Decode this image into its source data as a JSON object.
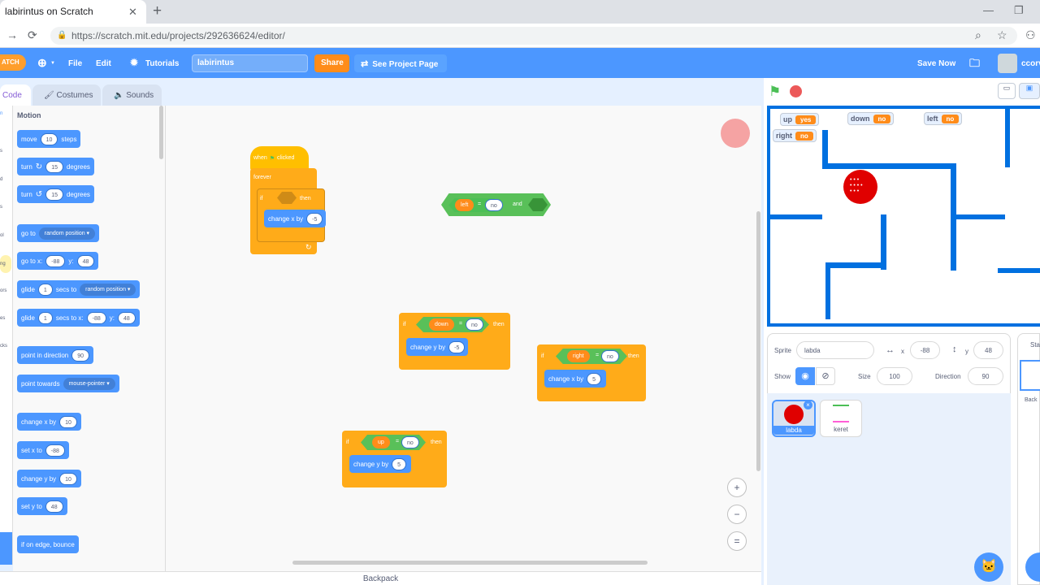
{
  "browser": {
    "tab_title": "labirintus on Scratch",
    "url": "https://scratch.mit.edu/projects/292636624/editor/"
  },
  "menu": {
    "file": "File",
    "edit": "Edit",
    "tutorials": "Tutorials",
    "project_title": "labirintus",
    "share": "Share",
    "see_project_page": "See Project Page",
    "save_now": "Save Now",
    "username": "ccorv"
  },
  "editor_tabs": {
    "code": "Code",
    "costumes": "Costumes",
    "sounds": "Sounds"
  },
  "categories": [
    "n",
    "s",
    "d",
    "s",
    "ol",
    "ng",
    "ors",
    "es",
    "cks"
  ],
  "palette": {
    "heading": "Motion",
    "blocks": [
      {
        "text": [
          "move",
          "10",
          "steps"
        ]
      },
      {
        "text": [
          "turn",
          "↻",
          "15",
          "degrees"
        ]
      },
      {
        "text": [
          "turn",
          "↺",
          "15",
          "degrees"
        ]
      },
      {
        "text": [
          "go to",
          "random position ▾"
        ]
      },
      {
        "text": [
          "go to x:",
          "-88",
          "y:",
          "48"
        ]
      },
      {
        "text": [
          "glide",
          "1",
          "secs to",
          "random position ▾"
        ]
      },
      {
        "text": [
          "glide",
          "1",
          "secs to x:",
          "-88",
          "y:",
          "48"
        ]
      },
      {
        "text": [
          "point in direction",
          "90"
        ]
      },
      {
        "text": [
          "point towards",
          "mouse-pointer ▾"
        ]
      },
      {
        "text": [
          "change x by",
          "10"
        ]
      },
      {
        "text": [
          "set x to",
          "-88"
        ]
      },
      {
        "text": [
          "change y by",
          "10"
        ]
      },
      {
        "text": [
          "set y to",
          "48"
        ]
      },
      {
        "text": [
          "if on edge, bounce"
        ]
      }
    ]
  },
  "script": {
    "hat": {
      "when": "when",
      "flag_icon": "green-flag",
      "clicked": "clicked"
    },
    "forever": "forever",
    "if1": {
      "if": "if",
      "then": "then",
      "change": "change x by",
      "val": "-5"
    },
    "reporter": {
      "var": "left",
      "eq": "=",
      "val": "no",
      "and": "and"
    },
    "if_down": {
      "if": "if",
      "var": "down",
      "eq": "=",
      "val": "no",
      "then": "then",
      "change": "change y by",
      "cval": "-5"
    },
    "if_right": {
      "if": "if",
      "var": "right",
      "eq": "=",
      "val": "no",
      "then": "then",
      "change": "change x by",
      "cval": "5"
    },
    "if_up": {
      "if": "if",
      "var": "up",
      "eq": "=",
      "val": "no",
      "then": "then",
      "change": "change y by",
      "cval": "5"
    }
  },
  "backpack": "Backpack",
  "monitors": [
    {
      "name": "up",
      "value": "yes"
    },
    {
      "name": "down",
      "value": "no"
    },
    {
      "name": "left",
      "value": "no"
    },
    {
      "name": "right",
      "value": "no"
    }
  ],
  "sprite_info": {
    "sprite_label": "Sprite",
    "sprite_name": "labda",
    "x_label": "x",
    "x": "-88",
    "y_label": "y",
    "y": "48",
    "show_label": "Show",
    "size_label": "Size",
    "size": "100",
    "direction_label": "Direction",
    "direction": "90"
  },
  "sprites": [
    {
      "name": "labda",
      "selected": true
    },
    {
      "name": "keret",
      "selected": false
    }
  ],
  "stage_panel": {
    "label": "Sta",
    "backdrops": "Back"
  },
  "colors": {
    "motion": "#4c97ff",
    "control": "#ffab19",
    "operators": "#59c059",
    "variables": "#ff8c1a",
    "maze": "#0070e0"
  }
}
